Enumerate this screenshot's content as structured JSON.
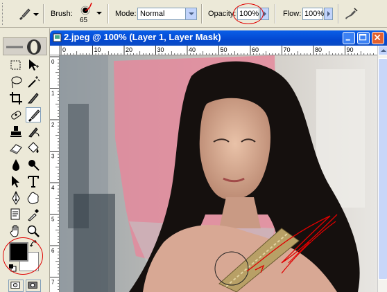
{
  "options_bar": {
    "brush_label": "Brush:",
    "brush_size": "65",
    "mode_label": "Mode:",
    "mode_value": "Normal",
    "opacity_label": "Opacity:",
    "opacity_value": "100%",
    "flow_label": "Flow:",
    "flow_value": "100%",
    "icons": [
      "brush-tool-icon",
      "brush-preview-icon",
      "airbrush-icon"
    ]
  },
  "document": {
    "title": "2.jpeg @ 100% (Layer 1, Layer Mask)",
    "ruler_h_ticks": [
      "0",
      "10",
      "20",
      "30",
      "40",
      "50",
      "60",
      "70",
      "80",
      "90"
    ],
    "ruler_v_ticks": [
      "0",
      "1",
      "2",
      "3",
      "4",
      "5",
      "6",
      "7"
    ]
  },
  "toolbox": {
    "tools": [
      "marquee-tool",
      "move-tool",
      "lasso-tool",
      "magic-wand-tool",
      "crop-tool",
      "slice-tool",
      "healing-brush-tool",
      "brush-tool",
      "clone-stamp-tool",
      "history-brush-tool",
      "eraser-tool",
      "paint-bucket-tool",
      "blur-tool",
      "dodge-tool",
      "path-selection-tool",
      "type-tool",
      "pen-tool",
      "custom-shape-tool",
      "notes-tool",
      "eyedropper-tool",
      "hand-tool",
      "zoom-tool"
    ],
    "foreground_color": "#000000",
    "background_color": "#FFFFFF"
  },
  "colors": {
    "annotation_red": "#E00000",
    "titlebar_blue": "#0A5FE8",
    "mask_pink": "#E48A9C"
  }
}
